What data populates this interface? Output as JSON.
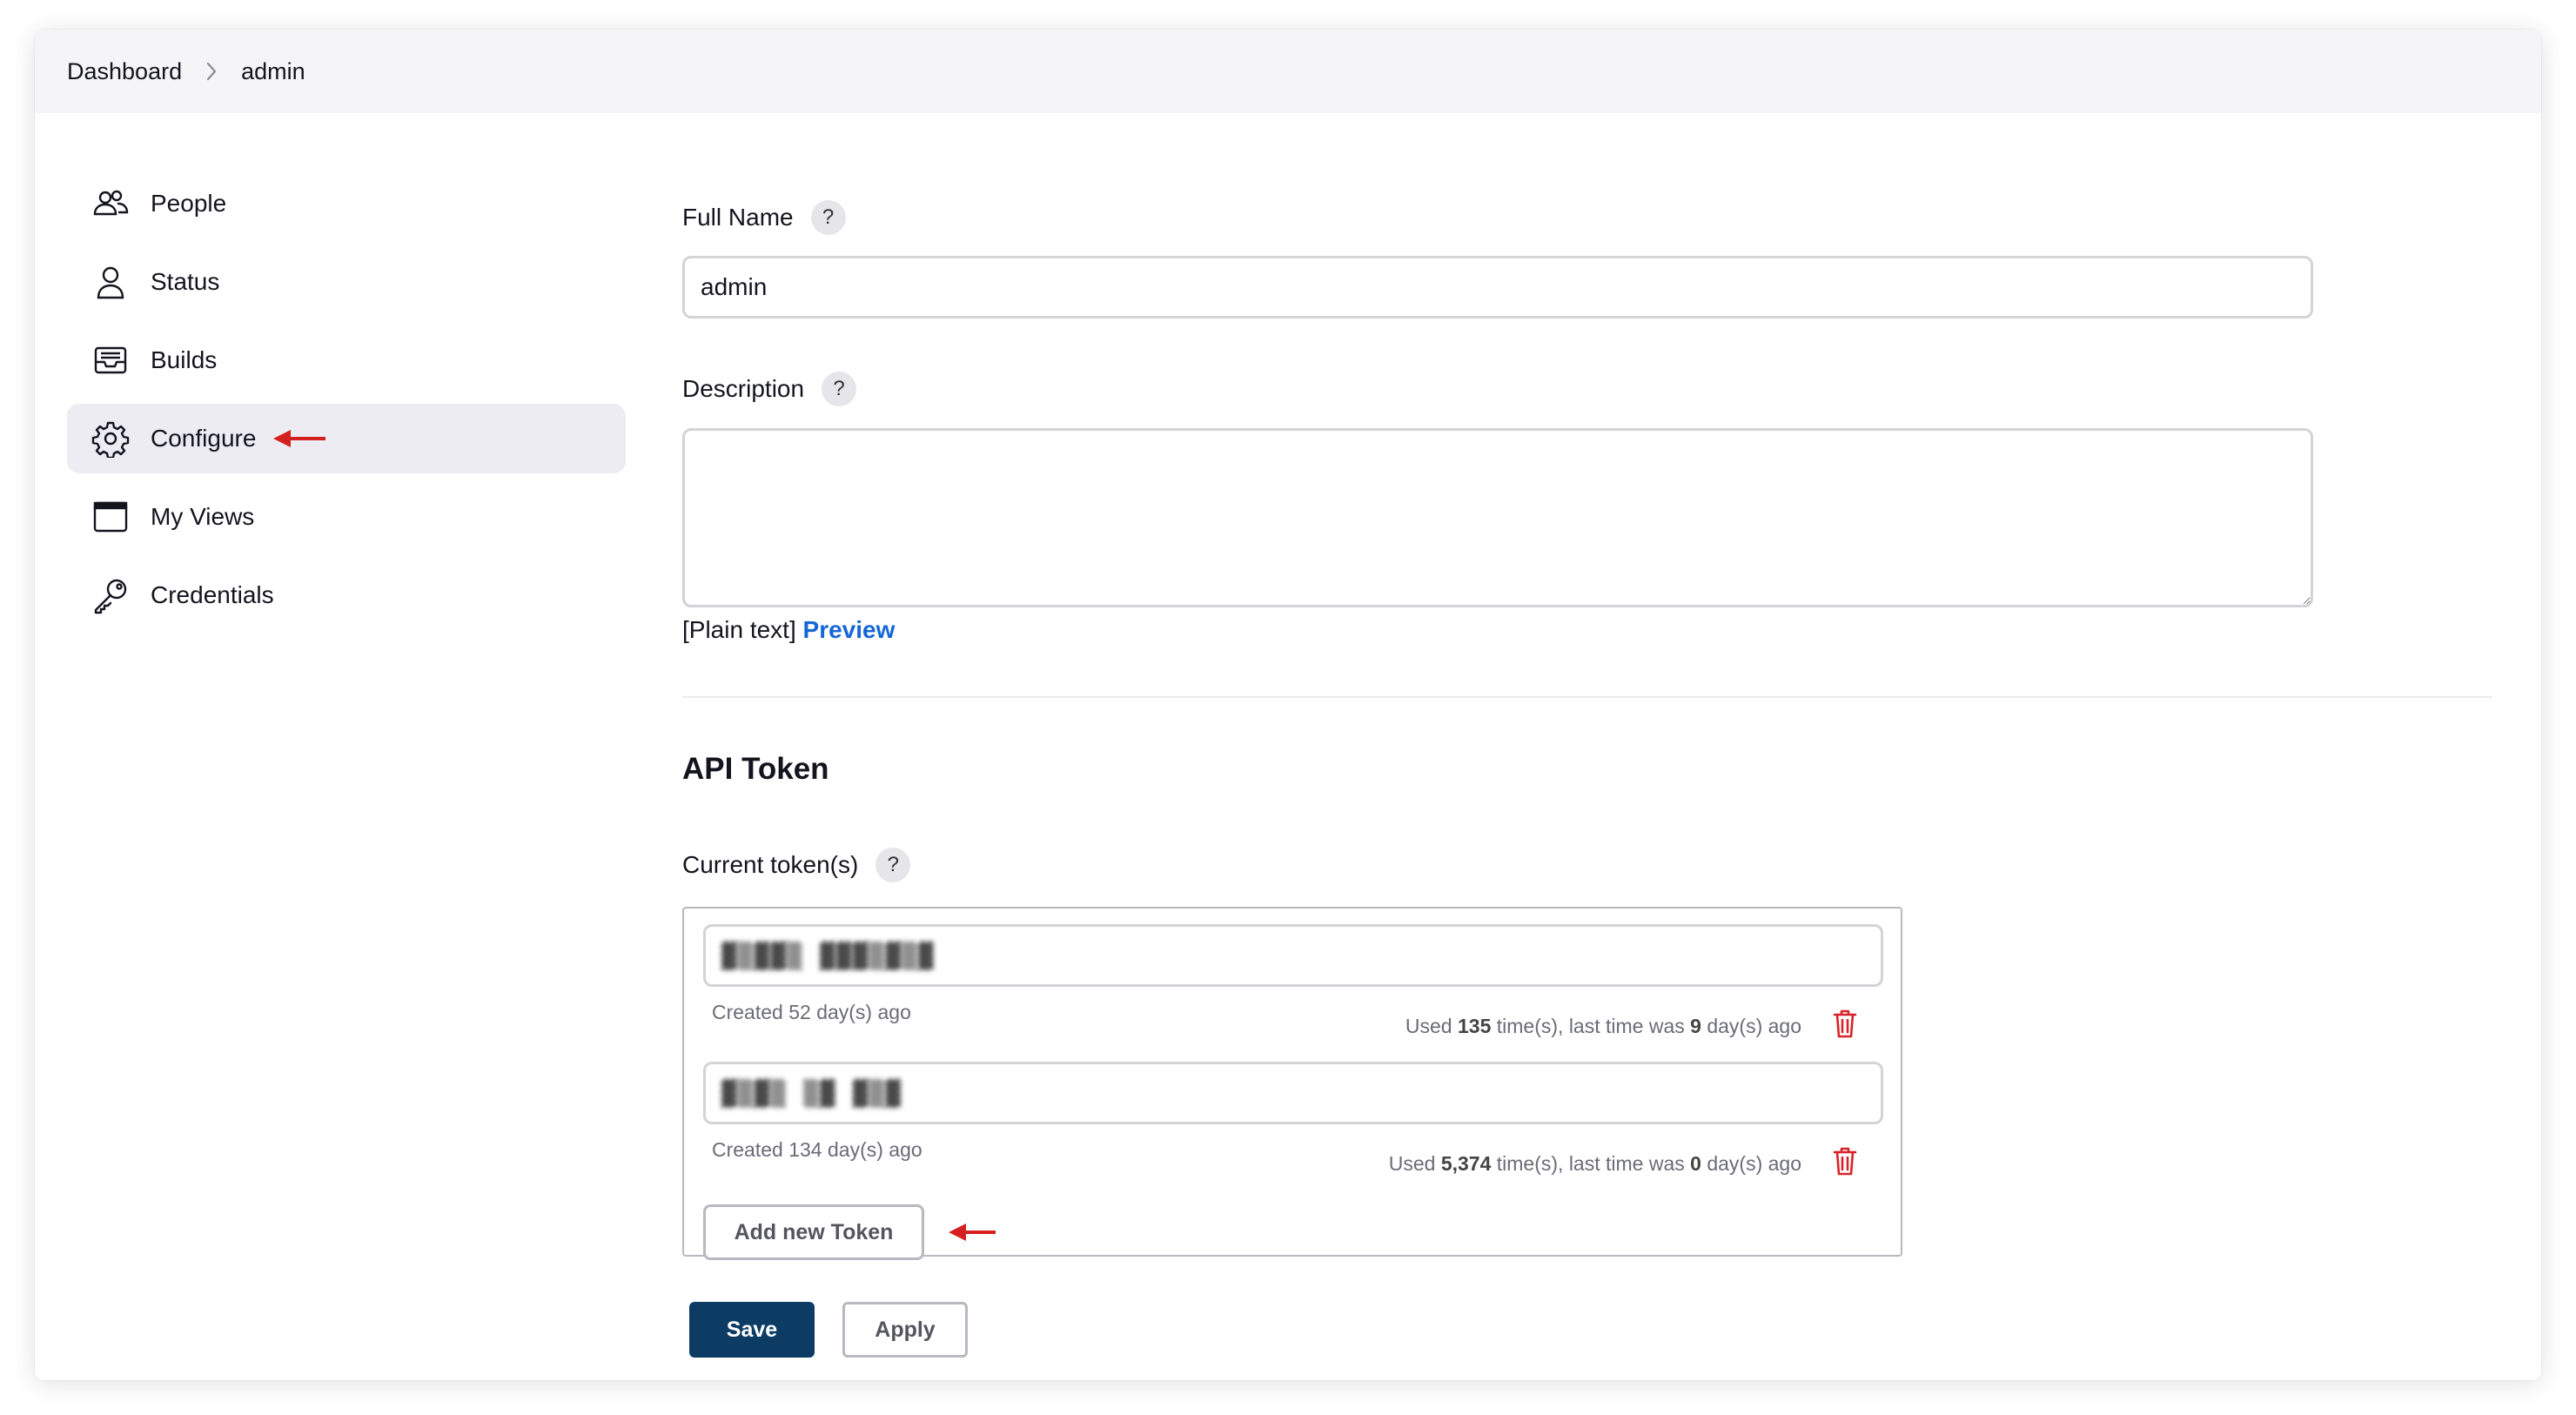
{
  "breadcrumb": {
    "items": [
      "Dashboard",
      "admin"
    ]
  },
  "sidebar": {
    "items": [
      {
        "label": "People",
        "icon": "people-icon"
      },
      {
        "label": "Status",
        "icon": "user-icon"
      },
      {
        "label": "Builds",
        "icon": "inbox-icon"
      },
      {
        "label": "Configure",
        "icon": "gear-icon",
        "active": true
      },
      {
        "label": "My Views",
        "icon": "window-icon"
      },
      {
        "label": "Credentials",
        "icon": "key-icon"
      }
    ]
  },
  "form": {
    "full_name": {
      "label": "Full Name",
      "help": "?",
      "value": "admin"
    },
    "description": {
      "label": "Description",
      "help": "?",
      "value": "",
      "format_text": "[Plain text]",
      "preview_label": "Preview"
    }
  },
  "api_token": {
    "title": "API Token",
    "current_label": "Current token(s)",
    "help": "?",
    "tokens": [
      {
        "name": "▓▒▓▓▒ ▓▓▓▒▓▒▓",
        "created": "Created 52 day(s) ago",
        "used_prefix": "Used ",
        "used_count": "135",
        "used_mid": " time(s), last time was ",
        "used_days": "9",
        "used_suffix": " day(s) ago"
      },
      {
        "name": "▓▒▓▒ ▒▓ ▓▒▓",
        "created": "Created 134 day(s) ago",
        "used_prefix": "Used ",
        "used_count": "5,374",
        "used_mid": " time(s), last time was ",
        "used_days": "0",
        "used_suffix": " day(s) ago"
      }
    ],
    "add_button": "Add new Token"
  },
  "actions": {
    "save": "Save",
    "apply": "Apply"
  },
  "colors": {
    "accent": "#0c3c64",
    "link": "#1566d6",
    "danger": "#d8232a",
    "annotation_arrow": "#d42020"
  }
}
